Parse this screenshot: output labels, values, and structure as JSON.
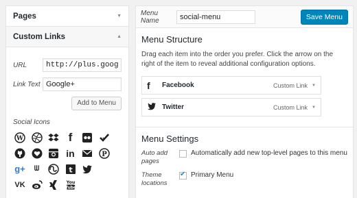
{
  "left": {
    "pages_header": "Pages",
    "custom_links_header": "Custom Links",
    "url_label": "URL",
    "url_value": "http://plus.google.c",
    "link_text_label": "Link Text",
    "link_text_value": "Google+",
    "add_button": "Add to Menu",
    "social_icons_label": "Social Icons",
    "social_icons": [
      "wordpress-icon",
      "dribbble-icon",
      "dropbox-icon",
      "facebook-icon",
      "flickr-icon",
      "foursquare-icon",
      "github-icon",
      "heart-icon",
      "instagram-icon",
      "linkedin-icon",
      "email-icon",
      "pinterest-icon",
      "googleplus-icon",
      "path-icon",
      "stumbleupon-icon",
      "tumblr-icon",
      "twitter-icon",
      "",
      "vk-icon",
      "weibo-icon",
      "xing-icon",
      "youtube-icon",
      "",
      ""
    ]
  },
  "right": {
    "menu_name_label": "Menu Name",
    "menu_name_value": "social-menu",
    "save_button": "Save Menu",
    "structure_title": "Menu Structure",
    "structure_desc": "Drag each item into the order you prefer. Click the arrow on the right of the item to reveal additional configuration options.",
    "items": [
      {
        "title": "Facebook",
        "type": "Custom Link"
      },
      {
        "title": "Twitter",
        "type": "Custom Link"
      }
    ],
    "settings_title": "Menu Settings",
    "auto_add_label": "Auto add pages",
    "auto_add_text": "Automatically add new top-level pages to this menu",
    "theme_locations_label": "Theme locations",
    "primary_menu_text": "Primary Menu",
    "primary_menu_checked": true
  }
}
